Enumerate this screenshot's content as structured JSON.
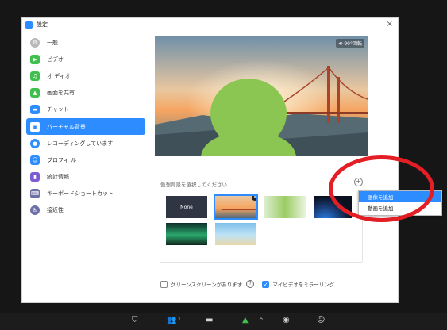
{
  "window": {
    "title": "設定",
    "close_glyph": "×"
  },
  "sidebar": {
    "items": [
      {
        "label": "一般",
        "icon": "gear-icon",
        "color": "#b9b9b9",
        "active": false
      },
      {
        "label": "ビデオ",
        "icon": "video-icon",
        "color": "#3fbf4d",
        "active": false
      },
      {
        "label": "オ ディオ",
        "icon": "headphones-icon",
        "color": "#3fbf4d",
        "active": false
      },
      {
        "label": "画面を共有",
        "icon": "share-screen-icon",
        "color": "#3fbf4d",
        "active": false
      },
      {
        "label": "チャット",
        "icon": "chat-icon",
        "color": "#2d8cff",
        "active": false
      },
      {
        "label": "バーチャル背景",
        "icon": "virtual-bg-icon",
        "color": "#2d8cff",
        "active": true
      },
      {
        "label": "レコーディングしています",
        "icon": "record-icon",
        "color": "#2d8cff",
        "active": false
      },
      {
        "label": "プロフィ ル",
        "icon": "profile-icon",
        "color": "#2d8cff",
        "active": false
      },
      {
        "label": "統計情報",
        "icon": "stats-icon",
        "color": "#7b5cd6",
        "active": false
      },
      {
        "label": "キーボードショートカット",
        "icon": "keyboard-icon",
        "color": "#6f6fa8",
        "active": false
      },
      {
        "label": "接近性",
        "icon": "accessibility-icon",
        "color": "#6f6fa8",
        "active": false
      }
    ]
  },
  "preview": {
    "mirror_label": "⟲ 90°回転"
  },
  "gallery": {
    "label": "仮想背景を選択してください",
    "add_glyph": "+",
    "none_label": "None",
    "remove_glyph": "×"
  },
  "context_menu": {
    "items": [
      "画像を追加",
      "動画を追加"
    ]
  },
  "options": {
    "green_screen_label": "グリーンスクリーンがあります",
    "mirror_label": "マイビデオをミラーリング",
    "help_glyph": "?",
    "check_glyph": "✓"
  },
  "toolbar": {
    "icons": [
      "security-icon",
      "participants-icon",
      "chat-icon",
      "share-screen-icon",
      "caret-up-icon",
      "record-icon",
      "reactions-icon"
    ],
    "participants_count": "1"
  },
  "colors": {
    "accent": "#2d8cff",
    "annotation_red": "#e31e24",
    "silhouette_green": "#8cc652"
  }
}
